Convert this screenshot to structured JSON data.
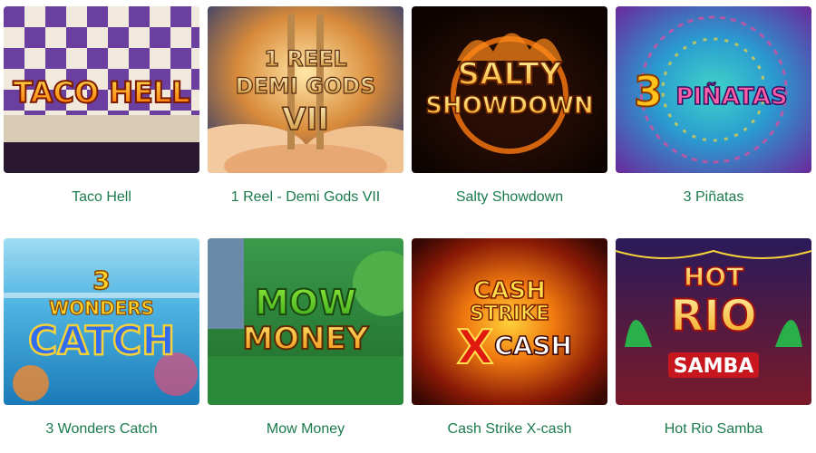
{
  "games": [
    {
      "title": "Taco Hell",
      "logo": [
        "TACO HELL"
      ]
    },
    {
      "title": "1 Reel - Demi Gods VII",
      "logo": [
        "1 REEL",
        "DEMI GODS",
        "VII"
      ]
    },
    {
      "title": "Salty Showdown",
      "logo": [
        "SALTY",
        "SHOWDOWN"
      ]
    },
    {
      "title": "3 Piñatas",
      "logo": [
        "3",
        "PIÑATAS"
      ]
    },
    {
      "title": "3 Wonders Catch",
      "logo": [
        "3",
        "WONDERS",
        "CATCH"
      ]
    },
    {
      "title": "Mow Money",
      "logo": [
        "MOW",
        "MONEY"
      ]
    },
    {
      "title": "Cash Strike X-cash",
      "logo": [
        "CASH",
        "STRIKE",
        "X",
        "CASH"
      ]
    },
    {
      "title": "Hot Rio Samba",
      "logo": [
        "HOT",
        "RIO",
        "SAMBA"
      ]
    }
  ],
  "colors": {
    "title_text": "#1a7a4c"
  }
}
